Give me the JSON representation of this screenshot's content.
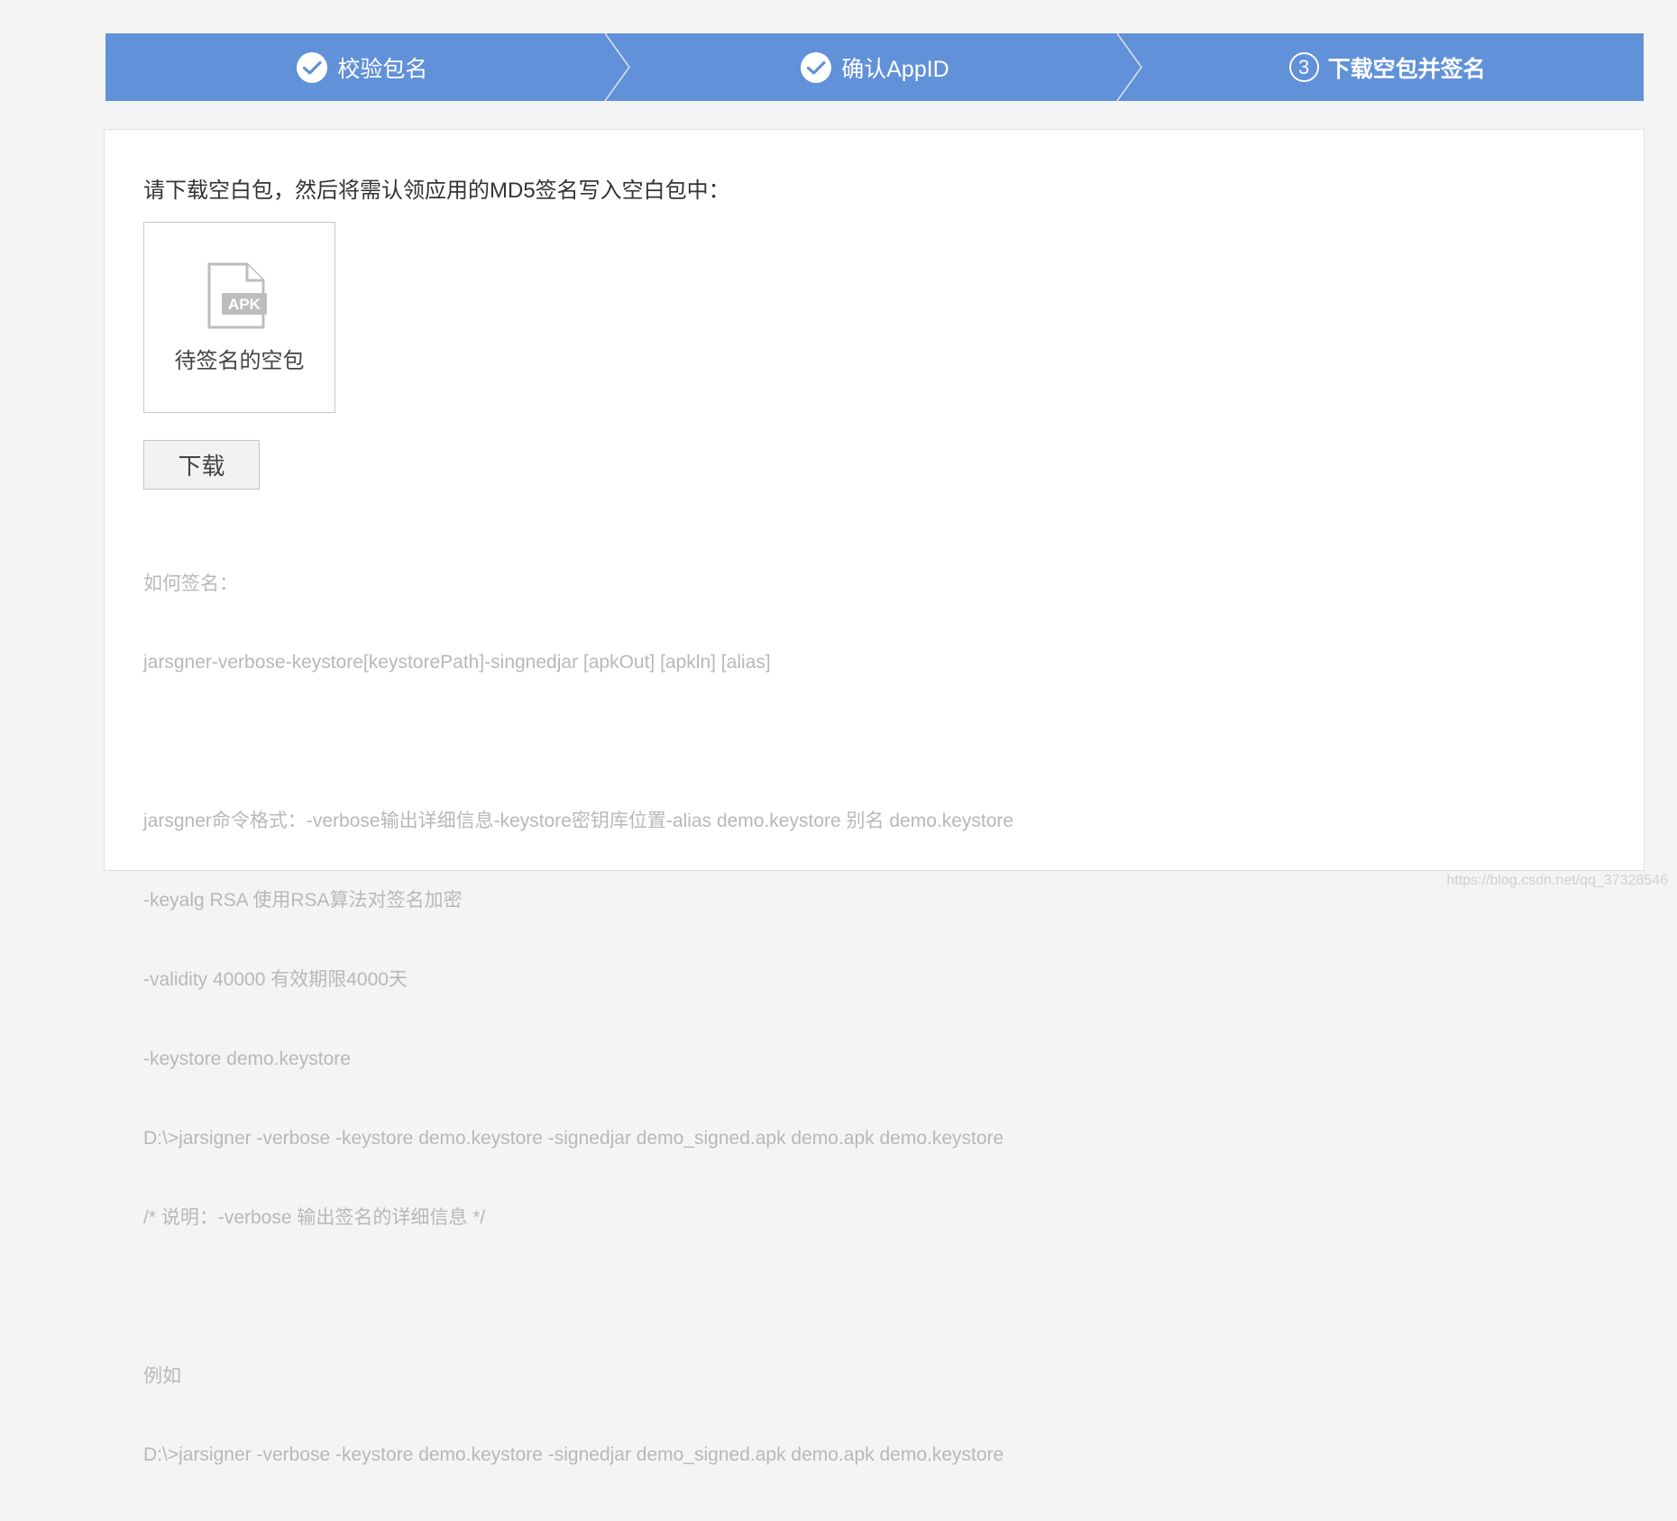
{
  "colors": {
    "steps_bar": "#6191d8",
    "page_bg": "#f4f4f4",
    "help_text": "#b8b8b8"
  },
  "steps": [
    {
      "label": "校验包名",
      "status": "done",
      "icon": "check-circle-icon"
    },
    {
      "label": "确认AppID",
      "status": "done",
      "icon": "check-circle-icon"
    },
    {
      "label": "下载空包并签名",
      "status": "active",
      "number": "3"
    }
  ],
  "panel": {
    "intro": "请下载空白包，然后将需认领应用的MD5签名写入空白包中：",
    "file_card": {
      "icon": "apk-file-icon",
      "icon_text": "APK",
      "caption": "待签名的空包"
    },
    "download_label": "下载",
    "help_lines": [
      "如何签名：",
      "jarsgner-verbose-keystore[keystorePath]-singnedjar [apkOut] [apkln] [alias]",
      "",
      "jarsgner命令格式：-verbose输出详细信息-keystore密钥库位置-alias demo.keystore 别名 demo.keystore",
      "-keyalg RSA 使用RSA算法对签名加密",
      "-validity 40000 有效期限4000天",
      "-keystore demo.keystore",
      "D:\\>jarsigner -verbose -keystore demo.keystore -signedjar demo_signed.apk demo.apk demo.keystore",
      "/* 说明：-verbose 输出签名的详细信息 */",
      "",
      "例如",
      "D:\\>jarsigner -verbose -keystore demo.keystore -signedjar demo_signed.apk demo.apk demo.keystore"
    ]
  },
  "watermark": "https://blog.csdn.net/qq_37328546"
}
